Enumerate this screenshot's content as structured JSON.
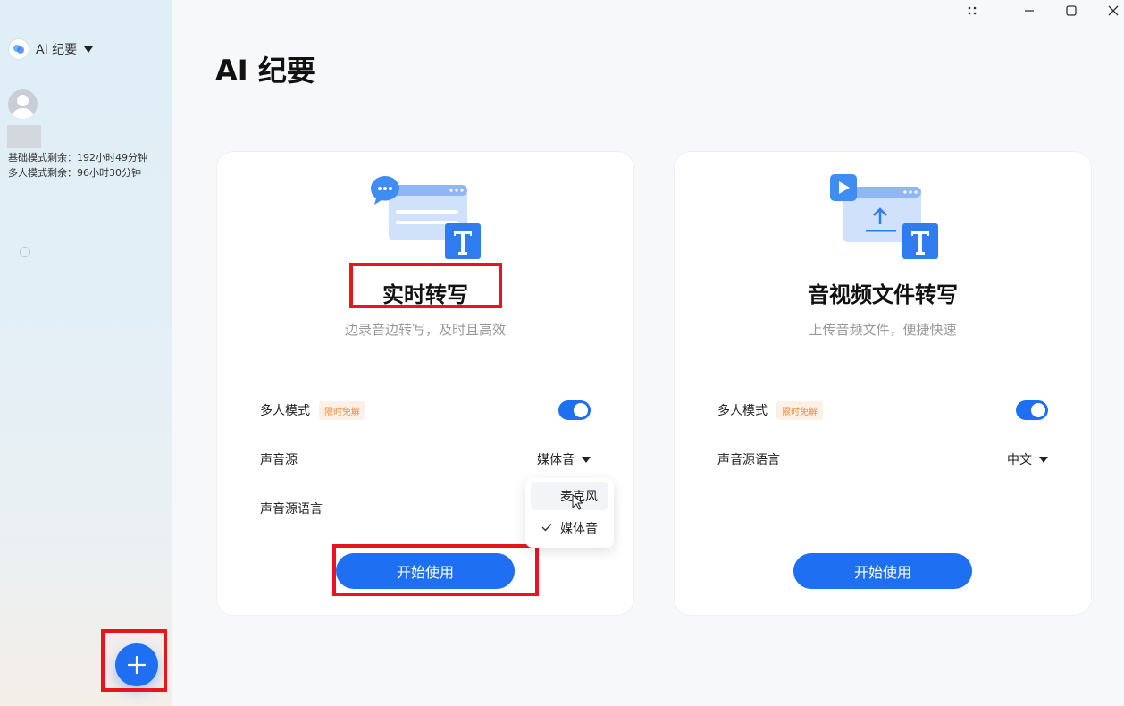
{
  "sidebar": {
    "app_name": "AI 纪要",
    "quota_basic": "基础模式剩余：192小时49分钟",
    "quota_multi": "多人模式剩余：96小时30分钟"
  },
  "page": {
    "title": "AI 纪要"
  },
  "cards": [
    {
      "title": "实时转写",
      "subtitle": "边录音边转写，及时且高效",
      "multi_mode_label": "多人模式",
      "multi_mode_tag": "限时免解",
      "multi_mode_on": true,
      "source_label": "声音源",
      "source_value": "媒体音",
      "language_label": "声音源语言",
      "start_label": "开始使用"
    },
    {
      "title": "音视频文件转写",
      "subtitle": "上传音频文件，便捷快速",
      "multi_mode_label": "多人模式",
      "multi_mode_tag": "限时免解",
      "multi_mode_on": true,
      "language_label": "声音源语言",
      "language_value": "中文",
      "start_label": "开始使用"
    }
  ],
  "source_dropdown": {
    "options": [
      "麦克风",
      "媒体音"
    ],
    "selected": "媒体音",
    "hovered": "麦克风"
  },
  "colors": {
    "accent": "#1f6ff2",
    "highlight": "#e8141f",
    "tag_text": "#f08a3c"
  }
}
